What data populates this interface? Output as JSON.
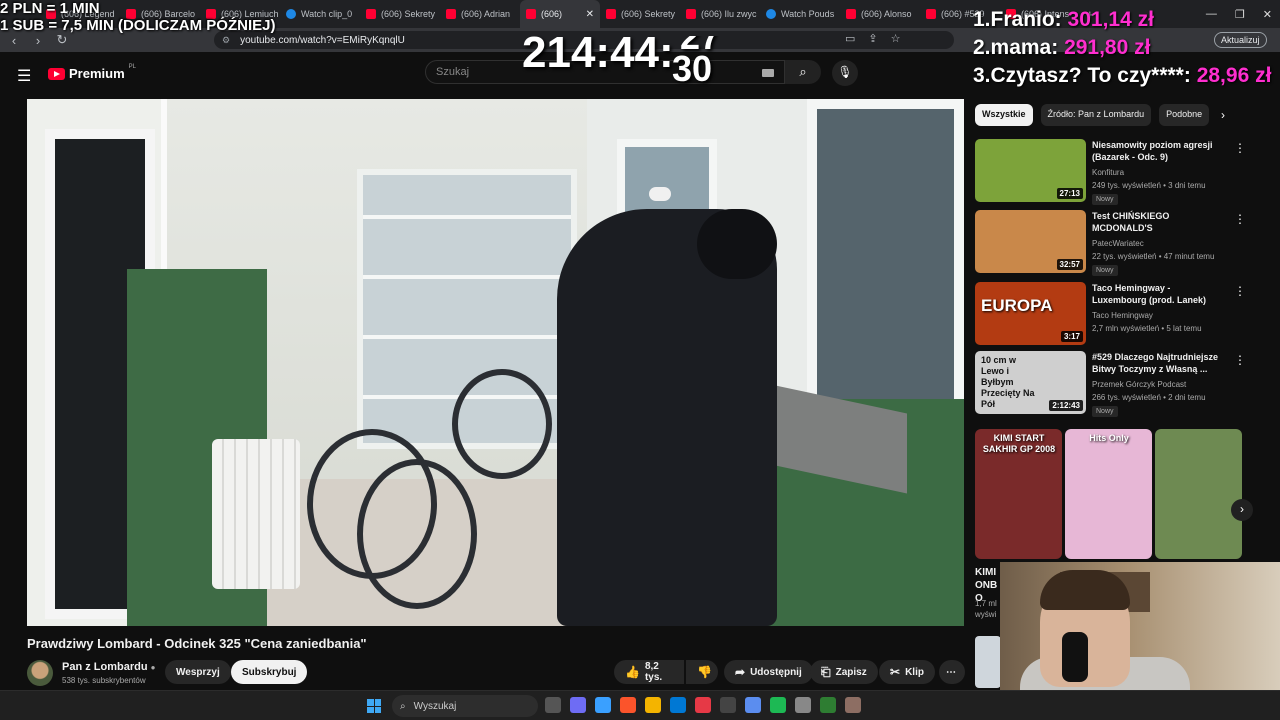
{
  "browser": {
    "tabs": [
      {
        "label": "(606) Legend",
        "fav": "red"
      },
      {
        "label": "(606) Barcelo",
        "fav": "red"
      },
      {
        "label": "(606) Lemiuch",
        "fav": "red"
      },
      {
        "label": "Watch clip_0",
        "fav": "blue"
      },
      {
        "label": "(606) Sekrety",
        "fav": "red"
      },
      {
        "label": "(606) Adrian",
        "fav": "red"
      },
      {
        "label": "(606)",
        "fav": "red",
        "active": true
      },
      {
        "label": "(606) Sekrety",
        "fav": "red"
      },
      {
        "label": "(606) Ilu zwyc",
        "fav": "red"
      },
      {
        "label": "Watch Pouds",
        "fav": "blue"
      },
      {
        "label": "(606) Alonso",
        "fav": "red"
      },
      {
        "label": "(606) #529",
        "fav": "red"
      },
      {
        "label": "(606) Intens",
        "fav": "red"
      }
    ],
    "url": "youtube.com/watch?v=EMiRyKqnqlU",
    "update_label": "Aktualizuj"
  },
  "overlay": {
    "rate_line1": "2 PLN = 1 MIN",
    "rate_line2": "1 SUB = 7,5 MIN (DOLICZAM PÓŹNIEJ)",
    "timer": "214:44:",
    "timer_seconds": "30",
    "timer_partial": "27",
    "donors": [
      {
        "rank": "1.",
        "name": "Franio:",
        "amount": "301,14 zł"
      },
      {
        "rank": "2.",
        "name": "mama:",
        "amount": "291,80 zł"
      },
      {
        "rank": "3.",
        "name": "Czytasz? To czy****:",
        "amount": "28,96 zł"
      }
    ]
  },
  "youtube": {
    "logo_text": "Premium",
    "logo_region": "PL",
    "search_placeholder": "Szukaj",
    "video_title": "Prawdziwy Lombard - Odcinek 325 \"Cena zaniedbania\"",
    "channel_name": "Pan z Lombardu",
    "channel_subs": "538 tys. subskrybentów",
    "support_label": "Wesprzyj",
    "subscribe_label": "Subskrybuj",
    "likes": "8,2 tys.",
    "share_label": "Udostępnij",
    "save_label": "Zapisz",
    "clip_label": "Klip",
    "chips": [
      "Wszystkie",
      "Źródło: Pan z Lombardu",
      "Podobne"
    ],
    "recommendations": [
      {
        "title": "Niesamowity poziom agresji (Bazarek - Odc. 9)",
        "channel": "Konfitura",
        "meta": "249 tys. wyświetleń • 3 dni temu",
        "badge": "Nowy",
        "duration": "27:13",
        "thumb_color": "#7da33a"
      },
      {
        "title": "Test CHIŃSKIEGO MCDONALD'S",
        "channel": "PatecWariatec",
        "meta": "22 tys. wyświetleń • 47 minut temu",
        "badge": "Nowy",
        "duration": "32:57",
        "thumb_color": "#c9884a"
      },
      {
        "title": "Taco Hemingway - Luxembourg (prod. Lanek)",
        "channel": "Taco Hemingway",
        "meta": "2,7 mln wyświetleń • 5 lat temu",
        "badge": "",
        "duration": "3:17",
        "thumb_text": "EUROPA",
        "thumb_color": "#b33b12"
      },
      {
        "title": "#529 Dlaczego Najtrudniejsze Bitwy Toczymy z Własną ...",
        "channel": "Przemek Górczyk Podcast",
        "meta": "266 tys. wyświetleń • 2 dni temu",
        "badge": "Nowy",
        "duration": "2:12:43",
        "thumb_text": "10 cm w Lewo i Byłbym Przecięty Na Pół",
        "thumb_color": "#cfcfcf"
      }
    ],
    "shorts": [
      {
        "label": "KIMI START SAKHIR GP 2008",
        "color": "#7a2a2a"
      },
      {
        "label": "Hits Only",
        "color": "#e7b7d6"
      },
      {
        "label": "",
        "color": "#6e8a52"
      }
    ],
    "low_title": "KIMI ONBO",
    "low_meta": "1,7 ml wyświ"
  },
  "taskbar": {
    "search_placeholder": "Wyszukaj",
    "icons": [
      "#555",
      "#6e6cf4",
      "#3aa0ff",
      "#fb542b",
      "#f4b400",
      "#0078d4",
      "#e63946",
      "#444",
      "#5b8def",
      "#1db954",
      "#888",
      "#2e7d32",
      "#8d6e63"
    ]
  }
}
